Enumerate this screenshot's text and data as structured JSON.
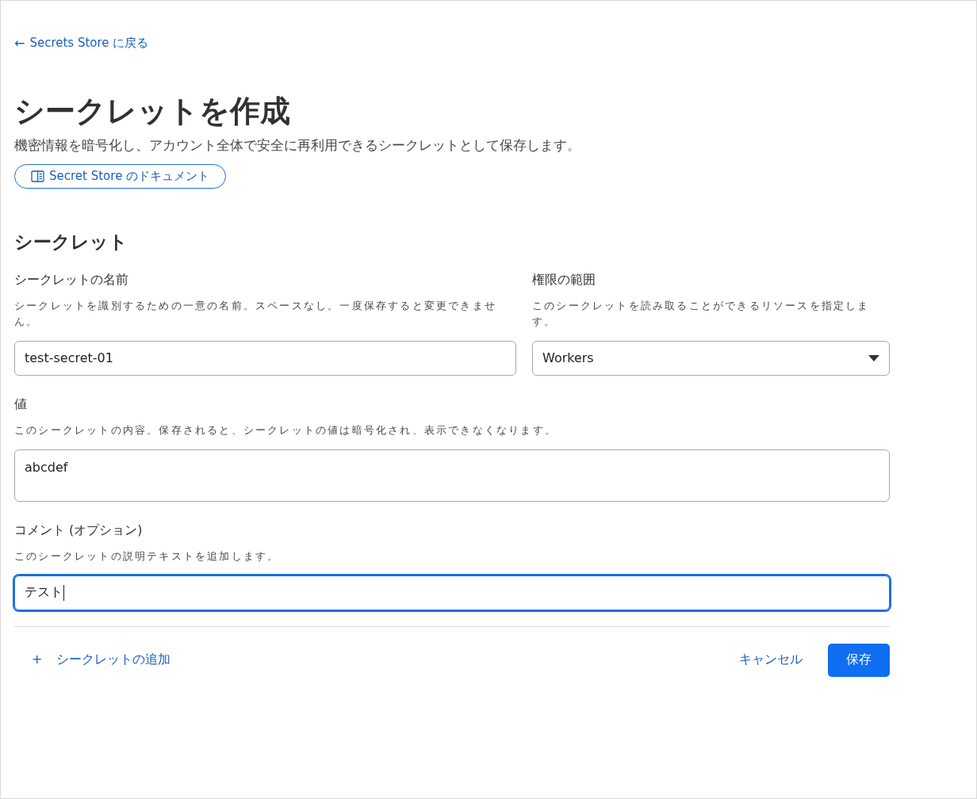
{
  "back_link": {
    "arrow": "←",
    "label": "Secrets Store に戻る"
  },
  "title": "シークレットを作成",
  "subtitle": "機密情報を暗号化し、アカウント全体で安全に再利用できるシークレットとして保存します。",
  "doc_button": {
    "label": "Secret Store のドキュメント"
  },
  "section": {
    "heading": "シークレット",
    "rows": [
      [
        {
          "kind": "text",
          "label": "シークレットの名前",
          "help": "シークレットを識別するための一意の名前。スペースなし。一度保存すると変更できません。",
          "value": "test-secret-01",
          "focused": false
        },
        {
          "kind": "select",
          "label": "権限の範囲",
          "help": "このシークレットを読み取ることができるリソースを指定します。",
          "value": "Workers",
          "focused": false
        }
      ],
      [
        {
          "kind": "textarea",
          "label": "値",
          "help": "このシークレットの内容。保存されると、シークレットの値は暗号化され、表示できなくなります。",
          "value": "abcdef",
          "focused": false
        }
      ],
      [
        {
          "kind": "text",
          "label": "コメント (オプション)",
          "help": "このシークレットの説明テキストを追加します。",
          "value": "テスト",
          "focused": true
        }
      ]
    ]
  },
  "footer": {
    "add_icon": "+",
    "add_label": "シークレットの追加",
    "cancel": "キャンセル",
    "save": "保存"
  }
}
